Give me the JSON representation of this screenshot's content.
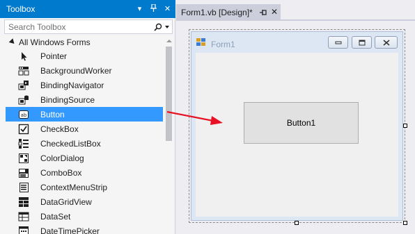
{
  "toolbox": {
    "title": "Toolbox",
    "search_placeholder": "Search Toolbox",
    "category_label": "All Windows Forms",
    "items": [
      {
        "label": "Pointer",
        "icon": "pointer-icon"
      },
      {
        "label": "BackgroundWorker",
        "icon": "backgroundworker-icon"
      },
      {
        "label": "BindingNavigator",
        "icon": "bindingnavigator-icon"
      },
      {
        "label": "BindingSource",
        "icon": "bindingsource-icon"
      },
      {
        "label": "Button",
        "icon": "button-icon",
        "selected": true
      },
      {
        "label": "CheckBox",
        "icon": "checkbox-icon"
      },
      {
        "label": "CheckedListBox",
        "icon": "checkedlistbox-icon"
      },
      {
        "label": "ColorDialog",
        "icon": "colordialog-icon"
      },
      {
        "label": "ComboBox",
        "icon": "combobox-icon"
      },
      {
        "label": "ContextMenuStrip",
        "icon": "contextmenustrip-icon"
      },
      {
        "label": "DataGridView",
        "icon": "datagridview-icon"
      },
      {
        "label": "DataSet",
        "icon": "dataset-icon"
      },
      {
        "label": "DateTimePicker",
        "icon": "datetimepicker-icon"
      }
    ]
  },
  "document": {
    "tab_label": "Form1.vb [Design]*",
    "form_title": "Form1",
    "button_text": "Button1"
  },
  "colors": {
    "accent": "#007acc",
    "selection": "#3399ff",
    "arrow": "#e81123"
  }
}
